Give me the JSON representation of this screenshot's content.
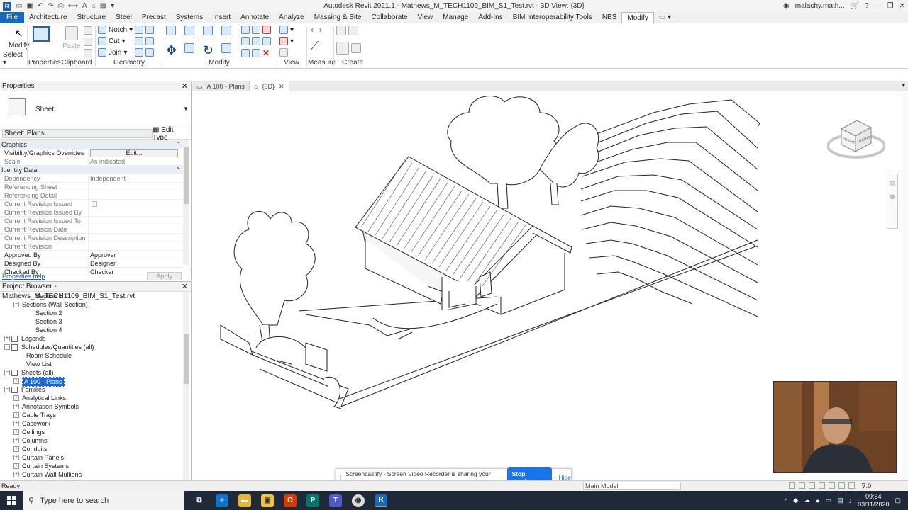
{
  "window": {
    "title": "Autodesk Revit 2021.1 - Mathews_M_TECH1109_BIM_S1_Test.rvt - 3D View: {3D}",
    "user": "malachy.math...",
    "help": "?"
  },
  "ribbon": {
    "tabs": [
      "File",
      "Architecture",
      "Structure",
      "Steel",
      "Precast",
      "Systems",
      "Insert",
      "Annotate",
      "Analyze",
      "Massing & Site",
      "Collaborate",
      "View",
      "Manage",
      "Add-Ins",
      "BIM Interoperability Tools",
      "NBS",
      "Modify"
    ],
    "active_tab": "Modify",
    "groups": {
      "select": "Select",
      "properties": "Properties",
      "clipboard": "Clipboard",
      "geometry": "Geometry",
      "modify": "Modify",
      "view": "View",
      "measure": "Measure",
      "create": "Create"
    },
    "buttons": {
      "modify": "Modify",
      "paste": "Paste",
      "notch": "Notch",
      "cut": "Cut",
      "join": "Join"
    }
  },
  "properties": {
    "title": "Properties",
    "type_name": "Sheet",
    "instance_selector": "Sheet: Plans",
    "edit_type": "Edit Type",
    "sections": {
      "graphics": "Graphics",
      "identity": "Identity Data"
    },
    "rows": [
      {
        "k": "Visibility/Graphics Overrides",
        "v": "Edit...",
        "dark": true,
        "button": true
      },
      {
        "k": "Scale",
        "v": "As indicated",
        "dark": false
      },
      {
        "k": "Dependency",
        "v": "Independent",
        "dark": false
      },
      {
        "k": "Referencing Sheet",
        "v": "",
        "dark": false
      },
      {
        "k": "Referencing Detail",
        "v": "",
        "dark": false
      },
      {
        "k": "Current Revision Issued",
        "v": "",
        "dark": false
      },
      {
        "k": "Current Revision Issued By",
        "v": "",
        "dark": false
      },
      {
        "k": "Current Revision Issued To",
        "v": "",
        "dark": false
      },
      {
        "k": "Current Revision Date",
        "v": "",
        "dark": false
      },
      {
        "k": "Current Revision Description",
        "v": "",
        "dark": false
      },
      {
        "k": "Current Revision",
        "v": "",
        "dark": false
      },
      {
        "k": "Approved By",
        "v": "Approver",
        "dark": true
      },
      {
        "k": "Designed By",
        "v": "Designer",
        "dark": true
      },
      {
        "k": "Checked By",
        "v": "Checker",
        "dark": true
      }
    ],
    "help_link": "Properties help",
    "apply": "Apply"
  },
  "browser": {
    "title": "Project Browser - Mathews_M_TECH1109_BIM_S1_Test.rvt",
    "nodes": [
      {
        "label": "Section 1",
        "indent": 3,
        "exp": "",
        "icon": false
      },
      {
        "label": "Sections (Wall Section)",
        "indent": 2,
        "exp": "−",
        "icon": false
      },
      {
        "label": "Section 2",
        "indent": 3,
        "exp": "",
        "icon": false
      },
      {
        "label": "Section 3",
        "indent": 3,
        "exp": "",
        "icon": false
      },
      {
        "label": "Section 4",
        "indent": 3,
        "exp": "",
        "icon": false
      },
      {
        "label": "Legends",
        "indent": 1,
        "exp": "+",
        "icon": true
      },
      {
        "label": "Schedules/Quantities (all)",
        "indent": 1,
        "exp": "−",
        "icon": true
      },
      {
        "label": "Room Schedule",
        "indent": 2,
        "exp": "",
        "icon": false
      },
      {
        "label": "View List",
        "indent": 2,
        "exp": "",
        "icon": false
      },
      {
        "label": "Sheets (all)",
        "indent": 1,
        "exp": "−",
        "icon": true
      },
      {
        "label": "A 100 - Plans",
        "indent": 2,
        "exp": "+",
        "icon": false,
        "selected": true
      },
      {
        "label": "Families",
        "indent": 1,
        "exp": "−",
        "icon": true
      },
      {
        "label": "Analytical Links",
        "indent": 2,
        "exp": "+",
        "icon": false
      },
      {
        "label": "Annotation Symbols",
        "indent": 2,
        "exp": "+",
        "icon": false
      },
      {
        "label": "Cable Trays",
        "indent": 2,
        "exp": "+",
        "icon": false
      },
      {
        "label": "Casework",
        "indent": 2,
        "exp": "+",
        "icon": false
      },
      {
        "label": "Ceilings",
        "indent": 2,
        "exp": "+",
        "icon": false
      },
      {
        "label": "Columns",
        "indent": 2,
        "exp": "+",
        "icon": false
      },
      {
        "label": "Conduits",
        "indent": 2,
        "exp": "+",
        "icon": false
      },
      {
        "label": "Curtain Panels",
        "indent": 2,
        "exp": "+",
        "icon": false
      },
      {
        "label": "Curtain Systems",
        "indent": 2,
        "exp": "+",
        "icon": false
      },
      {
        "label": "Curtain Wall Mullions",
        "indent": 2,
        "exp": "+",
        "icon": false
      }
    ]
  },
  "view_tabs": [
    {
      "label": "A 100 - Plans",
      "active": false
    },
    {
      "label": "{3D}",
      "active": true
    }
  ],
  "viewcube": {
    "front": "FRONT",
    "right": "RIGHT"
  },
  "share_banner": {
    "text": "Screencastify - Screen Video Recorder is sharing your screen.",
    "stop": "Stop sharing",
    "hide": "Hide"
  },
  "status": {
    "ready": "Ready",
    "model": "Main Model",
    "filter_count": ":0"
  },
  "taskbar": {
    "search_placeholder": "Type here to search",
    "time": "09:54",
    "date": "03/11/2020"
  }
}
